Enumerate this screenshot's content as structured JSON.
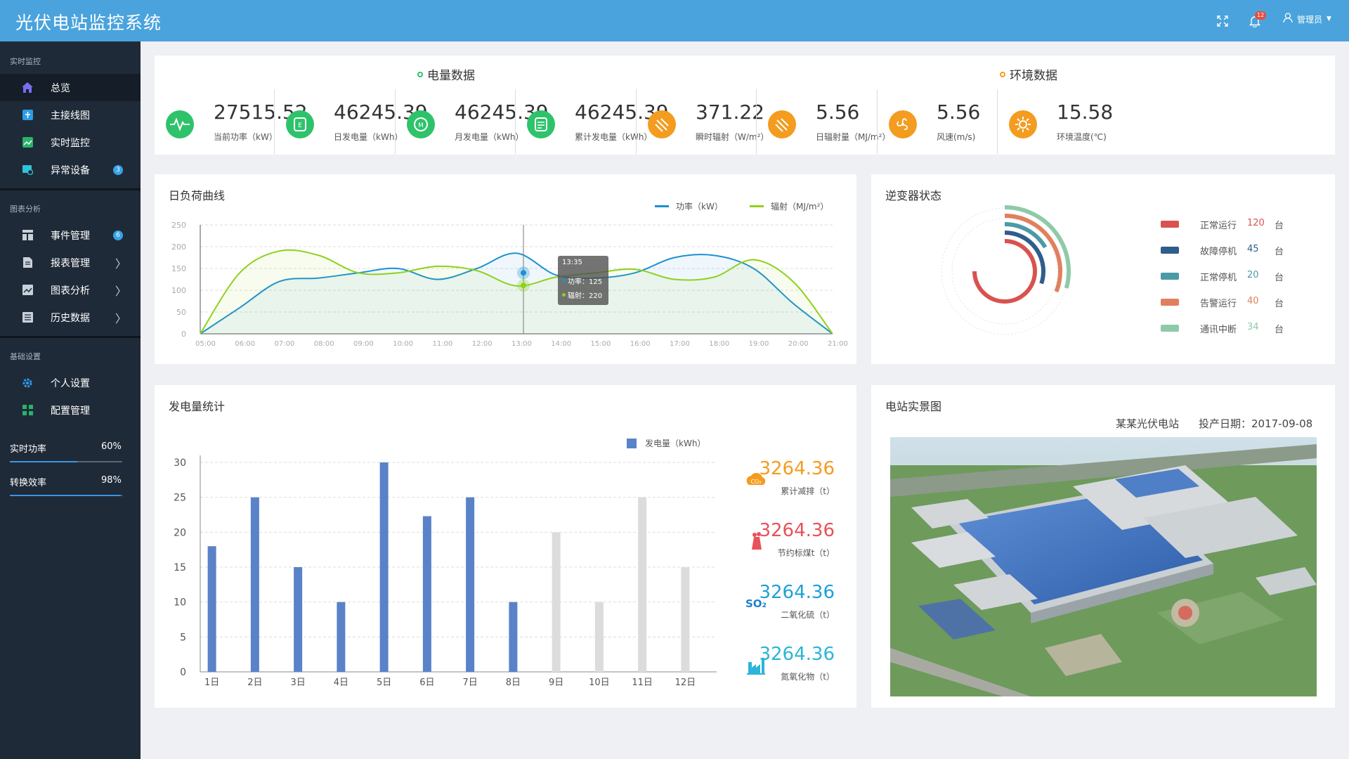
{
  "app": {
    "title": "光伏电站监控系统"
  },
  "header": {
    "notification_count": "12",
    "user_name": "管理员"
  },
  "sidebar": {
    "sections": [
      {
        "title": "实时监控",
        "items": [
          {
            "label": "总览",
            "icon": "home-icon",
            "active": true
          },
          {
            "label": "主接线图",
            "icon": "wiring-diagram-icon"
          },
          {
            "label": "实时监控",
            "icon": "monitor-chart-icon"
          },
          {
            "label": "异常设备",
            "icon": "alert-device-icon",
            "badge": "3"
          }
        ]
      },
      {
        "title": "图表分析",
        "items": [
          {
            "label": "事件管理",
            "icon": "event-table-icon",
            "badge": "6"
          },
          {
            "label": "报表管理",
            "icon": "report-file-icon",
            "arrow": "〉"
          },
          {
            "label": "图表分析",
            "icon": "analysis-chart-icon",
            "arrow": "〉"
          },
          {
            "label": "历史数据",
            "icon": "history-list-icon",
            "arrow": "〉"
          }
        ]
      },
      {
        "title": "基础设置",
        "items": [
          {
            "label": "个人设置",
            "icon": "gear-icon"
          },
          {
            "label": "配置管理",
            "icon": "grid-config-icon"
          }
        ]
      }
    ],
    "progress": [
      {
        "label": "实时功率",
        "value_text": "60%",
        "fraction": 0.6
      },
      {
        "label": "转换效率",
        "value_text": "98%",
        "fraction": 0.98
      }
    ]
  },
  "kpi": {
    "power_group_title": "电量数据",
    "env_group_title": "环境数据",
    "power_color": "#2ec36b",
    "env_color": "#f39c1f",
    "metrics": [
      {
        "value": "27515.52",
        "label": "当前功率（kW）",
        "icon": "pulse-icon",
        "group": "power"
      },
      {
        "value": "46245.39",
        "label": "日发电量（kWh）",
        "icon": "day-energy-icon",
        "group": "power"
      },
      {
        "value": "46245.39",
        "label": "月发电量（kWh）",
        "icon": "month-energy-icon",
        "group": "power"
      },
      {
        "value": "46245.39",
        "label": "累计发电量（kWh）",
        "icon": "total-energy-icon",
        "group": "power"
      },
      {
        "value": "371.22",
        "label": "瞬时辐射（W/m²）",
        "icon": "radiation-icon",
        "group": "env"
      },
      {
        "value": "5.56",
        "label": "日辐射量（MJ/m²）",
        "icon": "daily-radiation-icon",
        "group": "env"
      },
      {
        "value": "5.56",
        "label": "风速(m/s)",
        "icon": "fan-icon",
        "group": "env"
      },
      {
        "value": "15.58",
        "label": "环境温度(℃)",
        "icon": "sun-icon",
        "group": "env"
      }
    ]
  },
  "load_curve": {
    "title": "日负荷曲线",
    "tooltip": {
      "time": "13:35",
      "power_label": "功率：125",
      "radiation_label": "辐射：220"
    }
  },
  "inverter": {
    "title": "逆变器状态",
    "unit": "台",
    "statuses": [
      {
        "label": "正常运行",
        "count": "120",
        "color": "#d9524f"
      },
      {
        "label": "故障停机",
        "count": "45",
        "color": "#2f5d8c"
      },
      {
        "label": "正常停机",
        "count": "20",
        "color": "#4b9aa8"
      },
      {
        "label": "告警运行",
        "count": "40",
        "color": "#e0805f"
      },
      {
        "label": "通讯中断",
        "count": "34",
        "color": "#8fcaa8"
      }
    ]
  },
  "generation": {
    "title": "发电量统计"
  },
  "emissions": [
    {
      "value": "3264.36",
      "label": "累计减排（t）",
      "icon": "co2-cloud-icon",
      "color": "#f39c1f"
    },
    {
      "value": "3264.36",
      "label": "节约标煤t（t）",
      "icon": "coal-icon",
      "color": "#e8525a"
    },
    {
      "value": "3264.36",
      "label": "二氧化硫（t）",
      "icon": "so2-icon",
      "color": "#1ea0d8"
    },
    {
      "value": "3264.36",
      "label": "氮氧化物（t）",
      "icon": "factory-icon",
      "color": "#2bb5d8"
    }
  ],
  "station": {
    "title": "电站实景图",
    "name": "某某光伏电站",
    "date": "投产日期：2017-09-08"
  },
  "chart_data": [
    {
      "type": "line",
      "title": "",
      "x": [
        "05:00",
        "06:00",
        "07:00",
        "08:00",
        "09:00",
        "10:00",
        "11:00",
        "12:00",
        "13:00",
        "14:00",
        "15:00",
        "16:00",
        "17:00",
        "18:00",
        "19:00",
        "20:00",
        "21:00"
      ],
      "ylim": [
        0,
        250
      ],
      "yticks": [
        "250",
        "200",
        "150",
        "100",
        "50",
        "0"
      ],
      "series": [
        {
          "name": "功率（kW）",
          "color": "#1a91d1",
          "values": [
            0,
            60,
            120,
            128,
            140,
            150,
            125,
            150,
            185,
            135,
            128,
            140,
            175,
            180,
            150,
            70,
            0
          ]
        },
        {
          "name": "辐射（MJ/m²）",
          "color": "#8fd11c",
          "values": [
            0,
            140,
            190,
            180,
            140,
            140,
            155,
            145,
            110,
            130,
            140,
            148,
            125,
            130,
            170,
            120,
            0
          ]
        }
      ],
      "grid": true,
      "legend": "top-right"
    },
    {
      "type": "bar",
      "categories": [
        "1日",
        "2日",
        "3日",
        "4日",
        "5日",
        "6日",
        "7日",
        "8日",
        "9日",
        "10日",
        "11日",
        "12日"
      ],
      "ylim": [
        0,
        30
      ],
      "yticks": [
        "30",
        "25",
        "20",
        "15",
        "10",
        "5",
        "0"
      ],
      "series": [
        {
          "name": "发电量（kWh）",
          "values": [
            18,
            25,
            15,
            10,
            30,
            22.3,
            25,
            10,
            20,
            10,
            25,
            15
          ]
        }
      ],
      "highlight_count": 8,
      "highlight_color": "#5a82c8",
      "future_color": "#dcdcdc",
      "grid": true,
      "legend": "top-right"
    },
    {
      "type": "pie",
      "title": "",
      "categories": [
        "正常运行",
        "故障停机",
        "正常停机",
        "告警运行",
        "通讯中断"
      ],
      "values": [
        120,
        45,
        20,
        40,
        34
      ]
    }
  ]
}
